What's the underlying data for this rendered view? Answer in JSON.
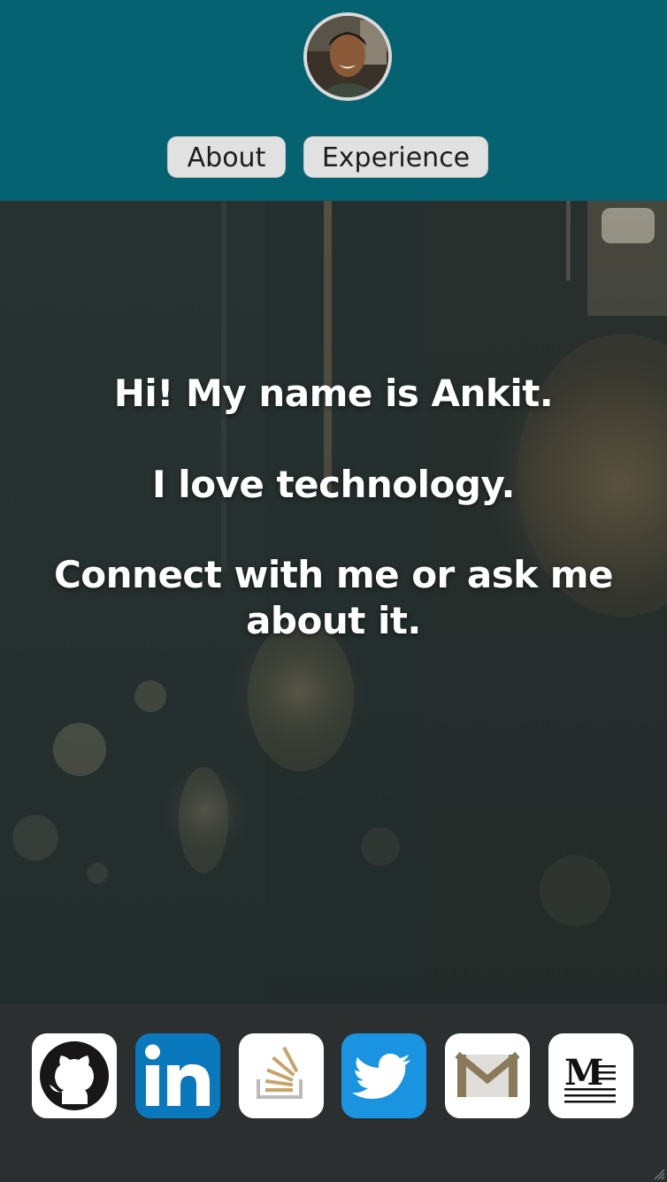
{
  "header": {
    "avatar_icon": "profile-photo",
    "bg_color": "#056271",
    "nav": [
      {
        "label": "About"
      },
      {
        "label": "Experience"
      }
    ]
  },
  "hero": {
    "line1": "Hi! My name is Ankit.",
    "line2": "I love technology.",
    "line3": "Connect with me or ask me about it."
  },
  "footer": {
    "bg_color": "#2b2f30",
    "social": [
      {
        "icon": "github-icon"
      },
      {
        "icon": "linkedin-icon"
      },
      {
        "icon": "stackoverflow-icon"
      },
      {
        "icon": "twitter-icon"
      },
      {
        "icon": "gmail-icon"
      },
      {
        "icon": "medium-icon"
      }
    ]
  }
}
